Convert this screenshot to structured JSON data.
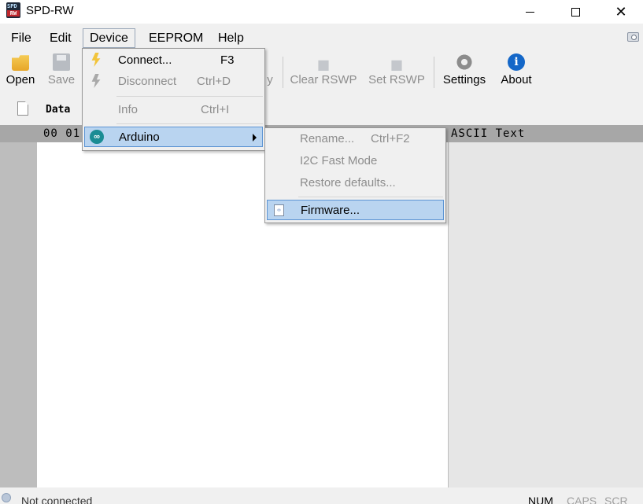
{
  "window": {
    "title": "SPD-RW",
    "icon_text_top": "SPD",
    "icon_text_bottom": "RW"
  },
  "menubar": {
    "items": [
      "File",
      "Edit",
      "Device",
      "EEPROM",
      "Help"
    ],
    "open_item": "Device"
  },
  "toolbar": {
    "open": "Open",
    "save": "Save",
    "hidden_partial": "y",
    "clear_rswp": "Clear RSWP",
    "set_rswp": "Set RSWP",
    "settings": "Settings",
    "about": "About",
    "about_icon_glyph": "i"
  },
  "tab": {
    "label": "Data"
  },
  "editor": {
    "hex_header": "00 01",
    "ascii_header": "ASCII Text"
  },
  "device_menu": {
    "connect": {
      "label": "Connect...",
      "shortcut": "F3",
      "icon": "connect-plug-icon"
    },
    "disconnect": {
      "label": "Disconnect",
      "shortcut": "Ctrl+D",
      "icon": "disconnect-plug-icon"
    },
    "info": {
      "label": "Info",
      "shortcut": "Ctrl+I"
    },
    "arduino": {
      "label": "Arduino",
      "icon": "arduino-icon",
      "icon_glyph": "∞"
    }
  },
  "arduino_submenu": {
    "rename": {
      "label": "Rename...",
      "shortcut": "Ctrl+F2"
    },
    "i2c_fast_mode": {
      "label": "I2C Fast Mode"
    },
    "restore_defaults": {
      "label": "Restore defaults..."
    },
    "firmware": {
      "label": "Firmware...",
      "icon": "firmware-file-icon",
      "icon_glyph": "‹›"
    }
  },
  "statusbar": {
    "status": "Not connected",
    "num": "NUM",
    "caps": "CAPS",
    "scr": "SCR"
  },
  "colors": {
    "highlight_bg": "#b9d4f0",
    "highlight_border": "#5c94d3",
    "disabled_text": "#8d8d8d",
    "about_blue": "#1467c8",
    "arduino_teal": "#1a8c94"
  }
}
